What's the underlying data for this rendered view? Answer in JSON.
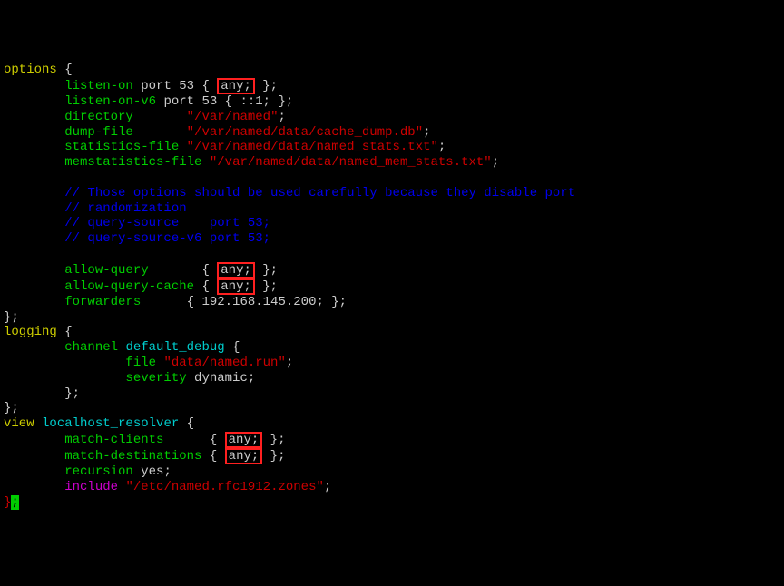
{
  "code": {
    "kw_options": "options",
    "brace_open": " {",
    "listen_on": "listen-on",
    "port_53": " port 53 { ",
    "any1": "any;",
    "close1": " };",
    "listen_on_v6": "listen-on-v6",
    "port_53_v6": " port 53 { ::1; };",
    "directory": "directory",
    "dir_pad": "       ",
    "dir_val": "\"/var/named\"",
    "semi": ";",
    "dump_file": "dump-file",
    "dump_pad": "       ",
    "dump_val": "\"/var/named/data/cache_dump.db\"",
    "stats_file": "statistics-file",
    "stats_pad": " ",
    "stats_val": "\"/var/named/data/named_stats.txt\"",
    "memstats_file": "memstatistics-file",
    "memstats_pad": " ",
    "memstats_val": "\"/var/named/data/named_mem_stats.txt\"",
    "comment1": "// Those options should be used carefully because they disable port",
    "comment2": "// randomization",
    "comment3": "// query-source    port 53;",
    "comment4": "// query-source-v6 port 53;",
    "allow_query": "allow-query",
    "aq_pad": "       { ",
    "any2": "any;",
    "aq_close": " };",
    "allow_query_cache": "allow-query-cache",
    "aqc_pad": " { ",
    "any3": "any;",
    "aqc_close": " };",
    "forwarders": "forwarders",
    "fwd_pad": "      { 192.168.145.200; };",
    "close_brace": "};",
    "logging": "logging",
    "channel": "channel",
    "default_debug": "default_debug",
    "db_open": " {",
    "file_kw": "file",
    "file_val": "\"data/named.run\"",
    "severity": "severity",
    "dynamic": " dynamic;",
    "ch_close": "};",
    "view": "view",
    "localhost_resolver": "localhost_resolver",
    "lr_open": " {",
    "match_clients": "match-clients",
    "mc_pad": "      { ",
    "any4": "any;",
    "mc_close": " };",
    "match_destinations": "match-destinations",
    "md_pad": " { ",
    "any5": "any;",
    "md_close": " };",
    "recursion": "recursion",
    "rec_val": " yes;",
    "include": "include",
    "inc_val": "\"/etc/named.rfc1912.zones\"",
    "close_quote": "}",
    "cursor": ";"
  }
}
